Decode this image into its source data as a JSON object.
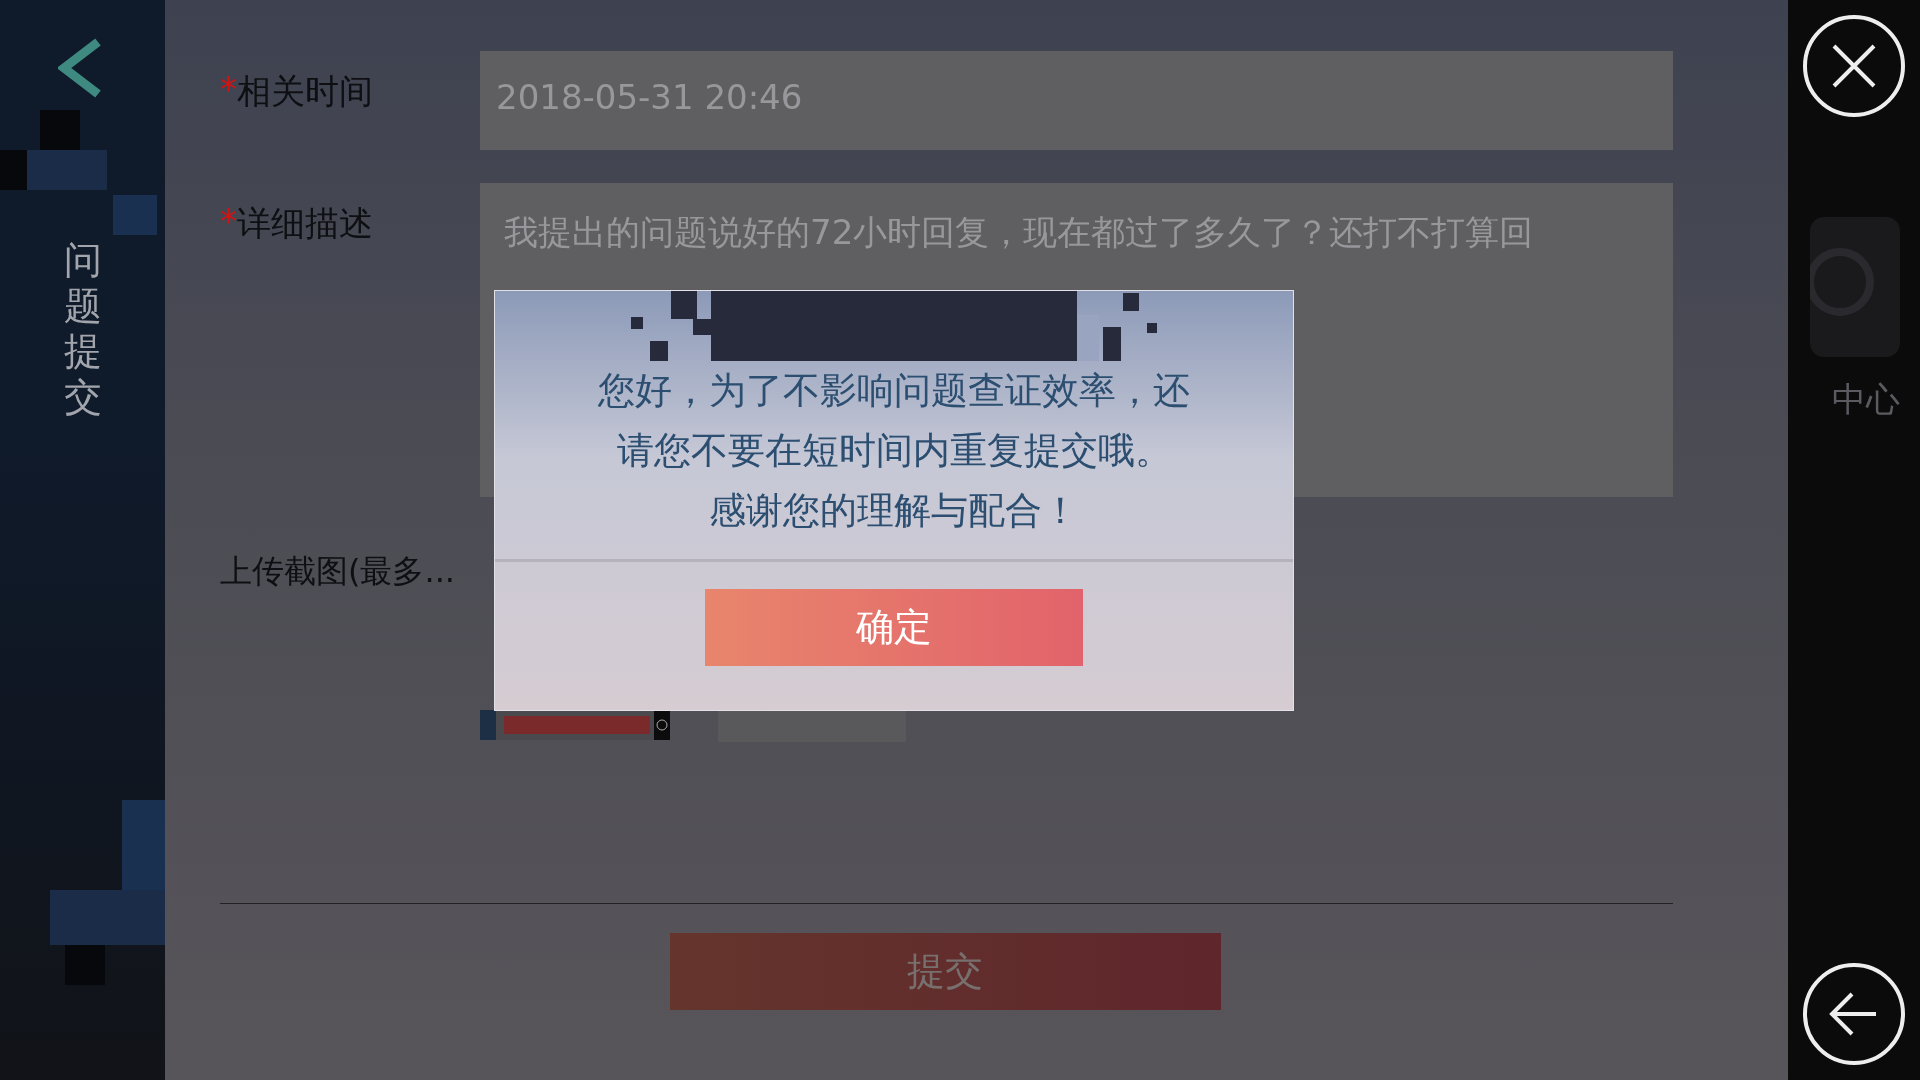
{
  "sidebar": {
    "title": "问题提交"
  },
  "form": {
    "required_mark": "*",
    "fields": [
      {
        "kind": "input",
        "required": true,
        "label": "相关时间",
        "value": "2018-05-31 20:46"
      },
      {
        "kind": "textarea",
        "required": true,
        "label": "详细描述",
        "value": "我提出的问题说好的72小时回复，现在都过了多久了？还打不打算回"
      }
    ],
    "upload": {
      "label": "上传截图(最多...",
      "thumbnails": [
        {
          "kind": "picture"
        },
        {
          "kind": "empty"
        }
      ]
    },
    "submit": "提交"
  },
  "right_panel": {
    "service_label": "中心"
  },
  "dialog": {
    "lines": [
      "您好，为了不影响问题查证效率，还",
      "请您不要在短时间内重复提交哦。",
      "感谢您的理解与配合！"
    ],
    "button": "确定"
  }
}
